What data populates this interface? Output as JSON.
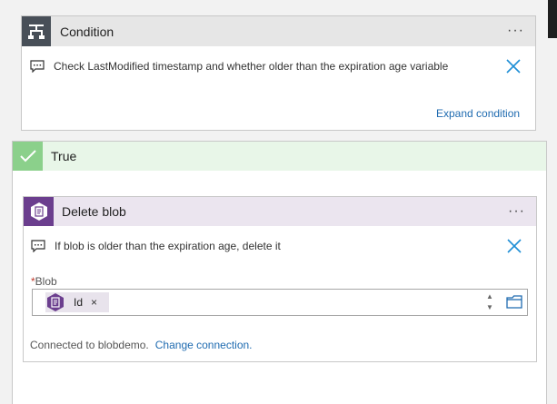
{
  "condition": {
    "title": "Condition",
    "more_label": "···",
    "comment": "Check LastModified timestamp and whether older than the expiration age variable",
    "expand_link": "Expand condition"
  },
  "true_branch": {
    "label": "True"
  },
  "delete_blob": {
    "title": "Delete blob",
    "more_label": "···",
    "comment": "If blob is older than the expiration age, delete it",
    "field": {
      "required_mark": "*",
      "label": "Blob",
      "token_label": "Id",
      "token_remove": "×"
    },
    "connection_text": "Connected to blobdemo.",
    "change_connection": "Change connection."
  },
  "colors": {
    "link": "#1f6bb0",
    "condition_icon_bg": "#484f58",
    "true_check_bg": "#8bd08b",
    "true_header_bg": "#e8f6e8",
    "blob_icon_bg": "#6b3e8e",
    "blob_header_bg": "#ebe5ef",
    "close_x": "#1f8fd6"
  }
}
